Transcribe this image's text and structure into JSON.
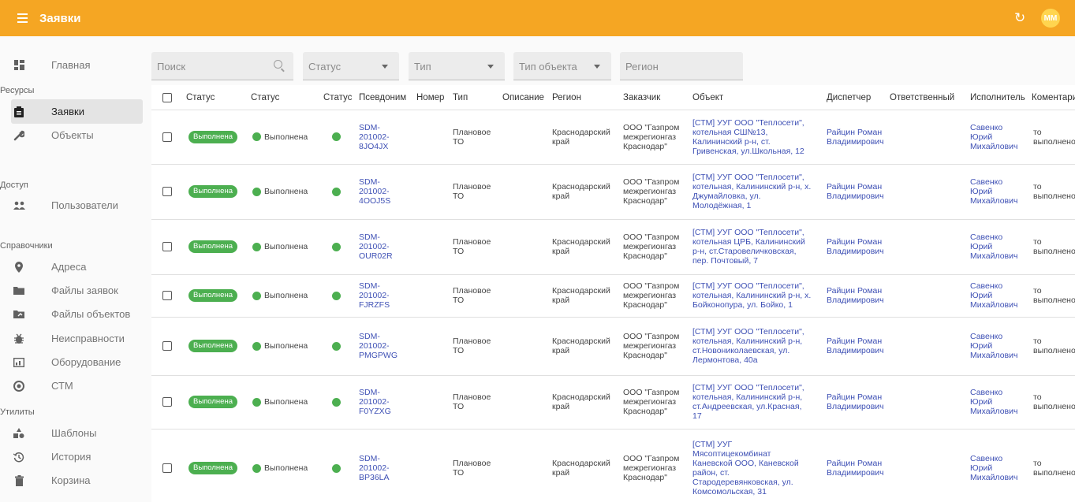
{
  "app": {
    "title": "Заявки",
    "avatar": "ММ",
    "refresh_icon": "refresh-icon",
    "menu_icon": "menu-icon",
    "brand_color": "#f5a623",
    "status_color": "#4caf50"
  },
  "sidebar": {
    "home": "Главная",
    "sec_resources": "Ресурсы",
    "requests": "Заявки",
    "objects": "Объекты",
    "sec_access": "Доступ",
    "users": "Пользователи",
    "sec_refs": "Справочники",
    "addresses": "Адреса",
    "req_files": "Файлы заявок",
    "obj_files": "Файлы объектов",
    "faults": "Неисправности",
    "equipment": "Оборудование",
    "ctm": "СТМ",
    "sec_utils": "Утилиты",
    "templates": "Шаблоны",
    "history": "История",
    "trash": "Корзина"
  },
  "filters": {
    "search": "Поиск",
    "status": "Статус",
    "type": "Тип",
    "obj_type": "Тип объекта",
    "region": "Регион"
  },
  "table": {
    "headers": {
      "status1": "Статус",
      "status2": "Статус",
      "status3": "Статус",
      "alias": "Псевдоним",
      "number": "Номер",
      "type": "Тип",
      "desc": "Описание",
      "region": "Регион",
      "customer": "Заказчик",
      "object": "Объект",
      "dispatcher": "Диспетчер",
      "responsible": "Ответственный",
      "executor": "Исполнитель",
      "comment": "Коментари"
    },
    "rows": [
      {
        "chip": "Выполнена",
        "status": "Выполнена",
        "alias": "SDM-\n201002-\n8JO4JX",
        "type": "Плановое\nТО",
        "region": "Краснодарский\nкрай",
        "customer": "ООО \"Газпром\nмежрегионгаз\nКраснодар\"",
        "object": "[СТМ] УУГ ООО \"Теплосети\",\nкотельная СШ№13,\nКалининский р-н, ст.\nГривенская, ул.Школьная, 12",
        "dispatcher": "Райцин Роман\nВладимирович",
        "executor": "Савенко\nЮрий\nМихайлович",
        "comment": "то\nвыполнено"
      },
      {
        "chip": "Выполнена",
        "status": "Выполнена",
        "alias": "SDM-\n201002-\n4OOJ5S",
        "type": "Плановое\nТО",
        "region": "Краснодарский\nкрай",
        "customer": "ООО \"Газпром\nмежрегионгаз\nКраснодар\"",
        "object": "[СТМ] УУГ ООО \"Теплосети\",\nкотельная, Калининский р-н, х.\nДжумайловка, ул.\nМолодёжная, 1",
        "dispatcher": "Райцин Роман\nВладимирович",
        "executor": "Савенко\nЮрий\nМихайлович",
        "comment": "то\nвыполнено"
      },
      {
        "chip": "Выполнена",
        "status": "Выполнена",
        "alias": "SDM-\n201002-\nOUR02R",
        "type": "Плановое\nТО",
        "region": "Краснодарский\nкрай",
        "customer": "ООО \"Газпром\nмежрегионгаз\nКраснодар\"",
        "object": "[СТМ] УУГ ООО \"Теплосети\",\nкотельная ЦРБ, Калининский\nр-н, ст.Старовеличковская,\nпер. Почтовый, 7",
        "dispatcher": "Райцин Роман\nВладимирович",
        "executor": "Савенко\nЮрий\nМихайлович",
        "comment": "то\nвыполнено"
      },
      {
        "chip": "Выполнена",
        "status": "Выполнена",
        "alias": "SDM-\n201002-\nFJRZFS",
        "type": "Плановое\nТО",
        "region": "Краснодарский\nкрай",
        "customer": "ООО \"Газпром\nмежрегионгаз\nКраснодар\"",
        "object": "[СТМ] УУГ ООО \"Теплосети\",\nкотельная, Калининский р-н, х.\nБойконопура, ул. Бойко, 1",
        "dispatcher": "Райцин Роман\nВладимирович",
        "executor": "Савенко\nЮрий\nМихайлович",
        "comment": "то\nвыполнено"
      },
      {
        "chip": "Выполнена",
        "status": "Выполнена",
        "alias": "SDM-\n201002-\nPMGPWG",
        "type": "Плановое\nТО",
        "region": "Краснодарский\nкрай",
        "customer": "ООО \"Газпром\nмежрегионгаз\nКраснодар\"",
        "object": "[СТМ] УУГ ООО \"Теплосети\",\nкотельная, Калининский р-н,\nст.Новониколаевская, ул.\nЛермонтова, 40а",
        "dispatcher": "Райцин Роман\nВладимирович",
        "executor": "Савенко\nЮрий\nМихайлович",
        "comment": "то\nвыполнено"
      },
      {
        "chip": "Выполнена",
        "status": "Выполнена",
        "alias": "SDM-\n201002-\nF0YZXG",
        "type": "Плановое\nТО",
        "region": "Краснодарский\nкрай",
        "customer": "ООО \"Газпром\nмежрегионгаз\nКраснодар\"",
        "object": "[СТМ] УУГ ООО \"Теплосети\",\nкотельная, Калининский р-н,\nст.Андреевская, ул.Красная,\n17",
        "dispatcher": "Райцин Роман\nВладимирович",
        "executor": "Савенко\nЮрий\nМихайлович",
        "comment": "то\nвыполнено"
      },
      {
        "chip": "Выполнена",
        "status": "Выполнена",
        "alias": "SDM-\n201002-\nBP36LA",
        "type": "Плановое\nТО",
        "region": "Краснодарский\nкрай",
        "customer": "ООО \"Газпром\nмежрегионгаз\nКраснодар\"",
        "object": "[СТМ] УУГ\nМясоптицекомбинат\nКаневской ООО, Каневской\nрайон, ст.\nСтародеревянковская, ул.\nКомсомольская, 31",
        "dispatcher": "Райцин Роман\nВладимирович",
        "executor": "Савенко\nЮрий\nМихайлович",
        "comment": "то\nвыполнено"
      }
    ]
  }
}
